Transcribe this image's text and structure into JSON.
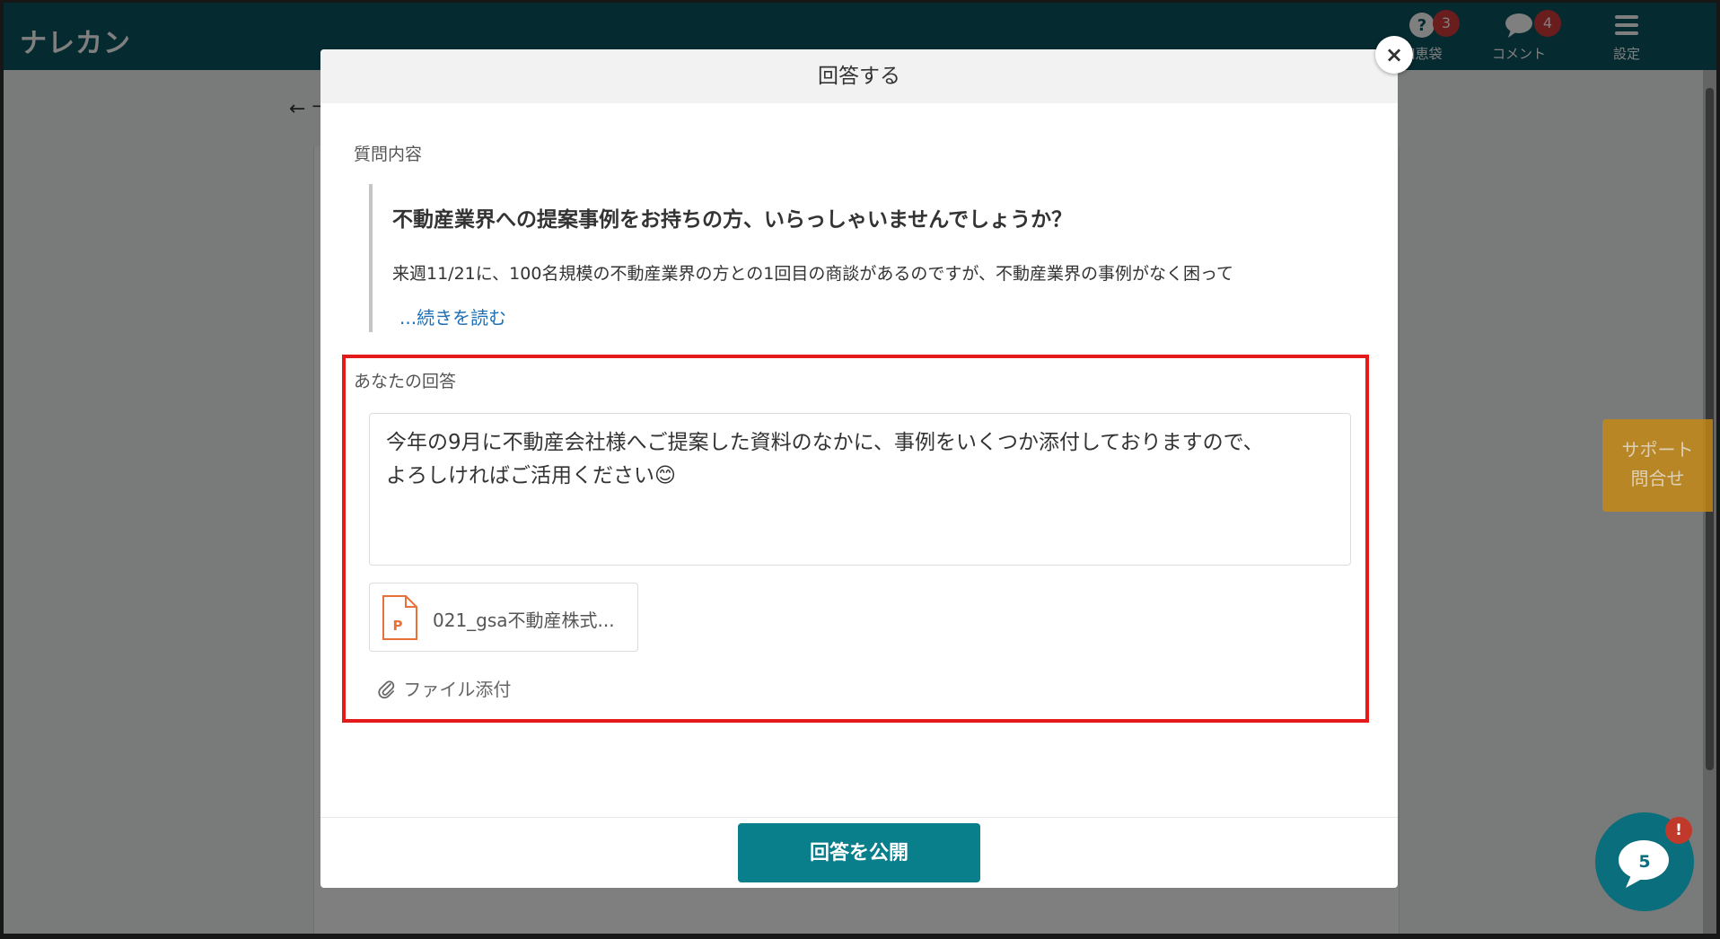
{
  "app": {
    "logo": "ナレカン"
  },
  "nav": [
    {
      "label": "知恵袋",
      "badge": "3",
      "icon": "question-icon"
    },
    {
      "label": "コメント",
      "badge": "4",
      "icon": "comment-icon"
    },
    {
      "label": "設定",
      "badge": "",
      "icon": "menu-icon"
    }
  ],
  "page": {
    "back_label": "← 卡"
  },
  "support_tab": {
    "line1": "サポート",
    "line2": "問合せ"
  },
  "chat": {
    "count": "5",
    "alert": "!"
  },
  "modal": {
    "title": "回答する",
    "close_label": "×",
    "question": {
      "section_label": "質問内容",
      "title": "不動産業界への提案事例をお持ちの方、いらっしゃいませんでしょうか？",
      "body": "来週11/21に、100名規模の不動産業界の方との1回目の商談があるのですが、不動産業界の事例がなく困って",
      "read_more": "...続きを読む"
    },
    "answer": {
      "section_label": "あなたの回答",
      "text_line1": "今年の9月に不動産会社様へご提案した資料のなかに、事例をいくつか添付しておりますので、",
      "text_line2": "よろしければご活用ください😊",
      "attachment_name": "021_gsa不動産株式...",
      "attachment_type": "P",
      "attach_label": "ファイル添付"
    },
    "publish_label": "回答を公開"
  },
  "colors": {
    "topbar": "#0b5560",
    "primary_button": "#0a7f8c",
    "highlight": "#e41a1a",
    "link": "#1e6fb5",
    "badge": "#d23b3b"
  }
}
